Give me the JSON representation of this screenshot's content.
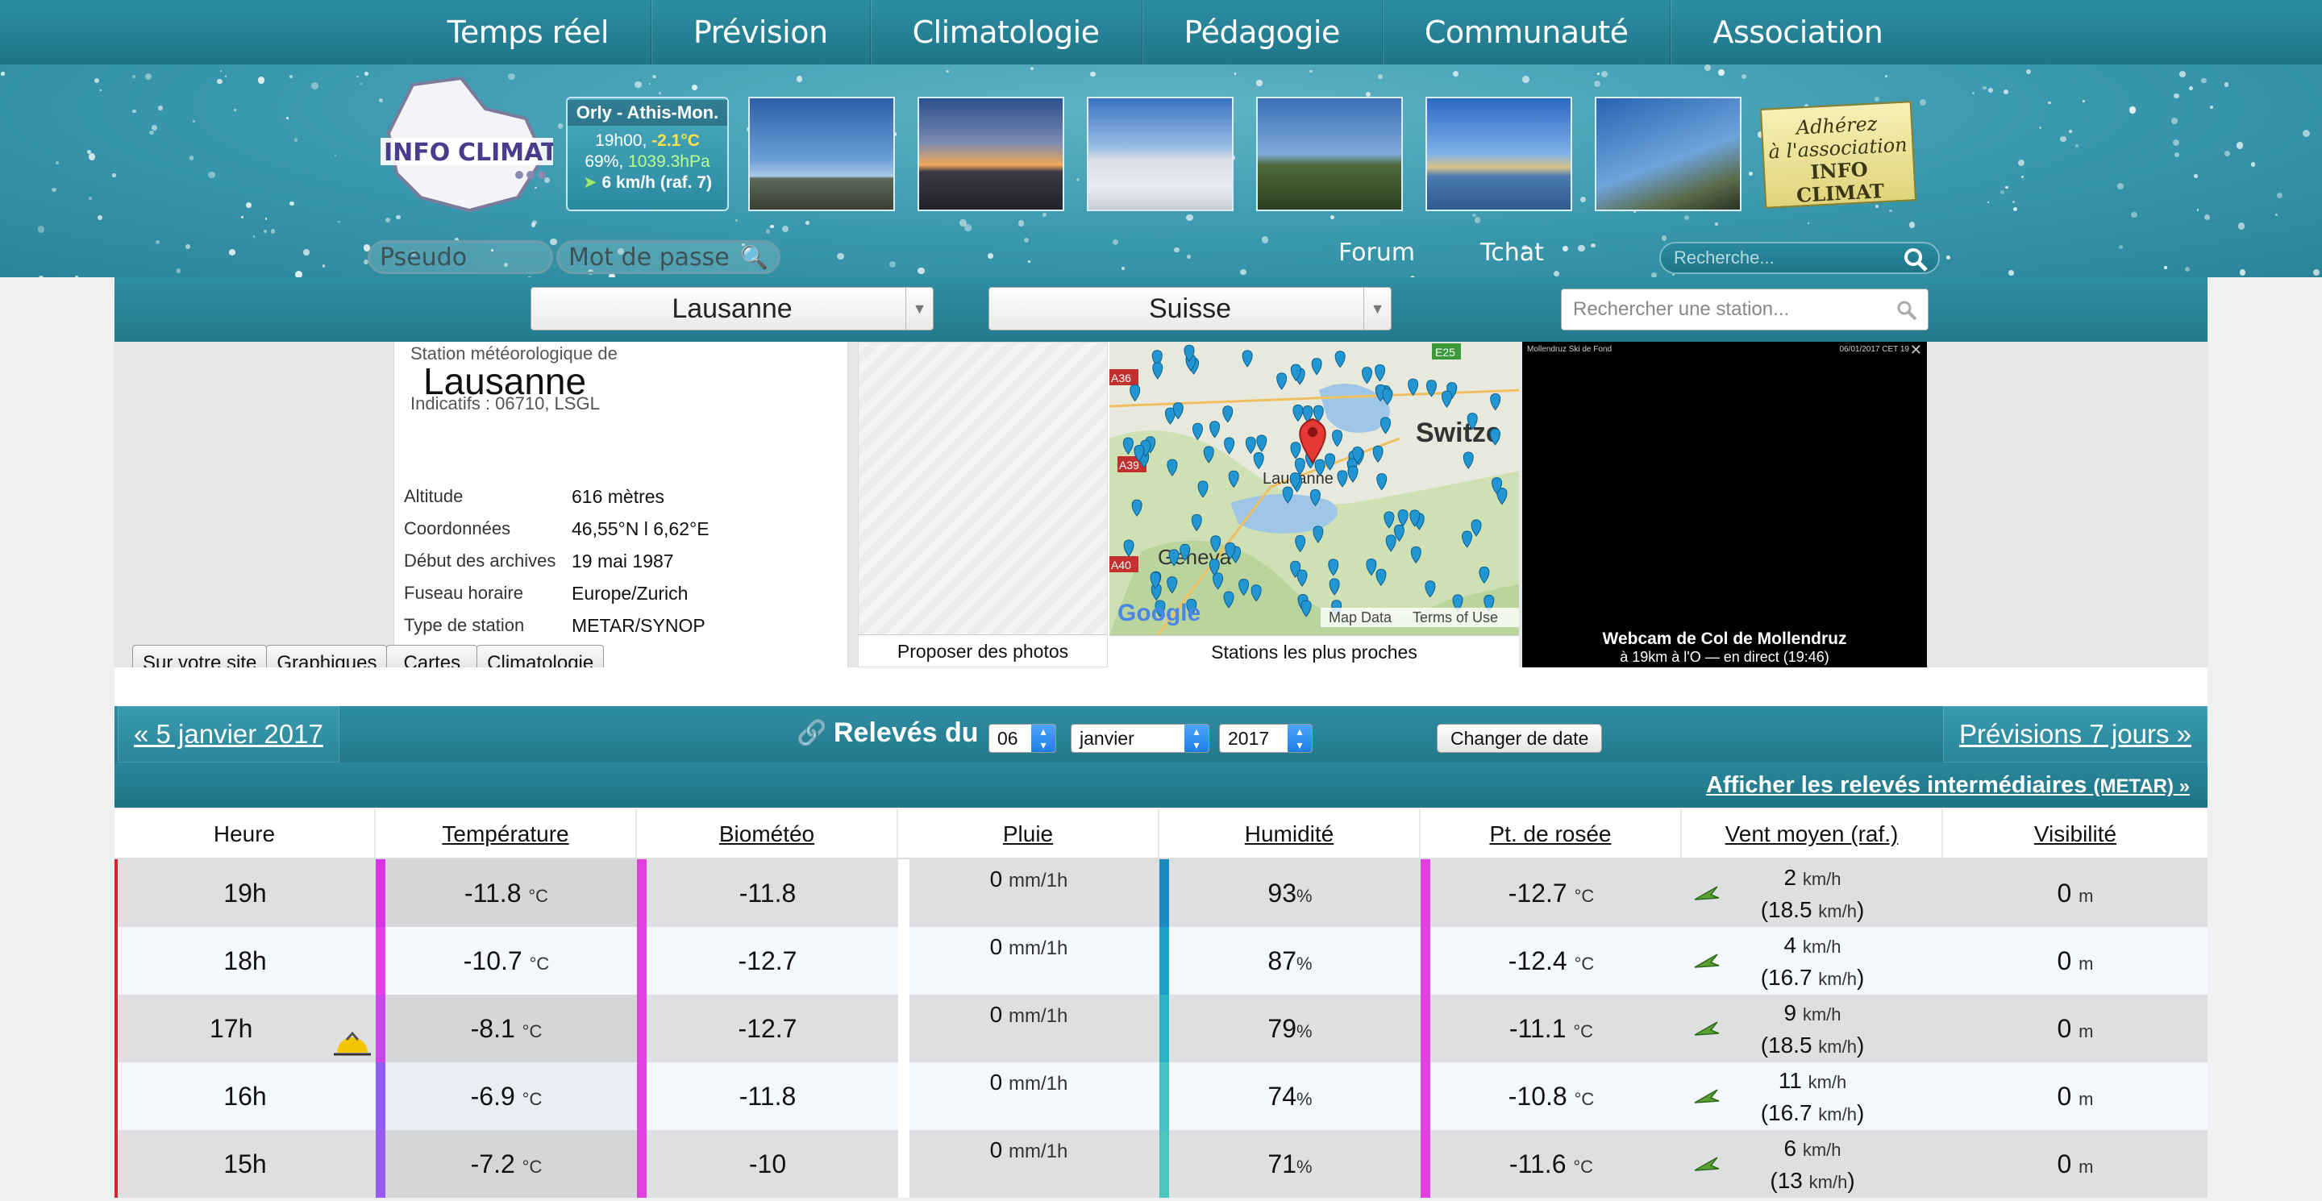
{
  "nav": [
    "Temps réel",
    "Prévision",
    "Climatologie",
    "Pédagogie",
    "Communauté",
    "Association"
  ],
  "observation": {
    "title": "Orly - Athis-Mon.",
    "time": "19h00, ",
    "temp": "-2.1°C",
    "hum": "69%, ",
    "press": "1039.3hPa",
    "wind": "6 km/h (raf. 7)"
  },
  "adhere": [
    "Adhérez",
    "à l'association",
    "INFO CLIMAT"
  ],
  "login": {
    "pseudo_placeholder": "Pseudo",
    "password_placeholder": "Mot de passe"
  },
  "links": {
    "forum": "Forum",
    "tchat": "Tchat"
  },
  "header_search_placeholder": "Recherche...",
  "selectors": {
    "city": "Lausanne",
    "country": "Suisse",
    "station_search_placeholder": "Rechercher une station..."
  },
  "station": {
    "pre": "Station météorologique de",
    "name": "Lausanne",
    "indicatifs": "Indicatifs : 06710, LSGL",
    "details": [
      {
        "k": "Altitude",
        "v": "616 mètres"
      },
      {
        "k": "Coordonnées",
        "v": "46,55°N l 6,62°E"
      },
      {
        "k": "Début des archives",
        "v": "19 mai 1987"
      },
      {
        "k": "Fuseau horaire",
        "v": "Europe/Zurich"
      },
      {
        "k": "Type de station",
        "v": "METAR/SYNOP"
      }
    ],
    "photos_caption": "Proposer des photos",
    "map_caption": "Stations les plus proches",
    "map_labels": {
      "geneva": "Geneva",
      "lausanne": "Lausanne",
      "switz": "Switze",
      "google": "Google",
      "mapdata": "Map Data",
      "terms": "Terms of Use",
      "a36": "A36",
      "a39": "A39",
      "a40": "A40",
      "e25": "E25"
    },
    "webcam_title": "Webcam de Col de Mollendruz",
    "webcam_sub": "à 19km à l'O — en direct (19:46)",
    "webcam_tiny": "Mollendruz Ski de Fond",
    "webcam_tiny2": "06/01/2017 CET 19"
  },
  "tabs": [
    "Sur votre site",
    "Graphiques",
    "Cartes",
    "Climatologie"
  ],
  "releves": {
    "prev": "« 5 janvier 2017",
    "title": "Relevés du",
    "day": "06",
    "month": "janvier",
    "year": "2017",
    "change": "Changer de date",
    "next": "Prévisions 7 jours »",
    "metar_link": "Afficher les relevés intermédiaires",
    "metar_small": "(METAR) »"
  },
  "table": {
    "headers": [
      "Heure",
      "Température",
      "Biométéo",
      "Pluie",
      "Humidité",
      "Pt. de rosée",
      "Vent moyen (raf.)",
      "Visibilité"
    ],
    "rows": [
      {
        "heure": "19h",
        "temp": "-11.8",
        "bio": "-11.8",
        "pluie": "0",
        "hum": "93",
        "rosee": "-12.7",
        "vent": "2",
        "raf": "18.5",
        "vis": "0"
      },
      {
        "heure": "18h",
        "temp": "-10.7",
        "bio": "-12.7",
        "pluie": "0",
        "hum": "87",
        "rosee": "-12.4",
        "vent": "4",
        "raf": "16.7",
        "vis": "0"
      },
      {
        "heure": "17h",
        "temp": "-8.1",
        "bio": "-12.7",
        "pluie": "0",
        "hum": "79",
        "rosee": "-11.1",
        "vent": "9",
        "raf": "18.5",
        "vis": "0"
      },
      {
        "heure": "16h",
        "temp": "-6.9",
        "bio": "-11.8",
        "pluie": "0",
        "hum": "74",
        "rosee": "-10.8",
        "vent": "11",
        "raf": "16.7",
        "vis": "0"
      },
      {
        "heure": "15h",
        "temp": "-7.2",
        "bio": "-10",
        "pluie": "0",
        "hum": "71",
        "rosee": "-11.6",
        "vent": "6",
        "raf": "13",
        "vis": "0"
      }
    ],
    "units": {
      "temp": "°C",
      "rain": "mm/1h",
      "hum": "%",
      "wind": "km/h",
      "vis": "m"
    }
  },
  "colors": {
    "header": "#2a889c",
    "magenta": "#e040e0",
    "violet": "#9b5ef0",
    "hum_dark": "#1a8fbf",
    "hum_light": "#46c2c2",
    "red": "#d8242a"
  }
}
